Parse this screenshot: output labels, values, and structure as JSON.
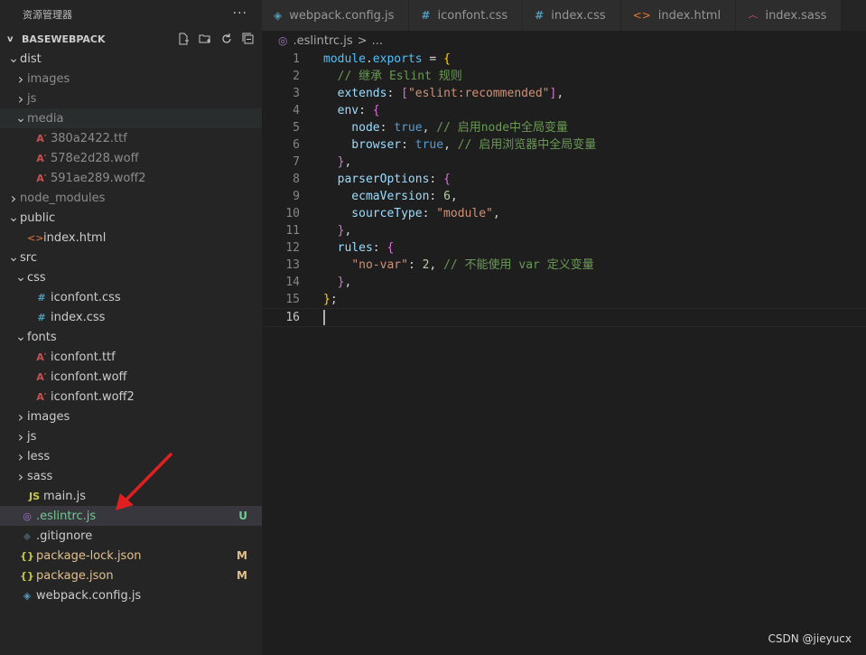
{
  "sidebar": {
    "title": "资源管理器",
    "more": "···",
    "section": "BASEWEBPACK",
    "actions": [
      "new-file",
      "new-folder",
      "refresh",
      "collapse-all"
    ],
    "tree": [
      {
        "label": "dist",
        "indent": 1,
        "twistie": "v",
        "icon": "",
        "kind": "folder"
      },
      {
        "label": "images",
        "indent": 2,
        "twistie": ">",
        "icon": "",
        "kind": "folder",
        "dim": true
      },
      {
        "label": "js",
        "indent": 2,
        "twistie": ">",
        "icon": "",
        "kind": "folder",
        "dim": true
      },
      {
        "label": "media",
        "indent": 2,
        "twistie": "v",
        "icon": "",
        "kind": "folder",
        "dim": true,
        "hover": true
      },
      {
        "label": "380a2422.ttf",
        "indent": 3,
        "twistie": "",
        "icon": "font",
        "kind": "file",
        "dim": true
      },
      {
        "label": "578e2d28.woff",
        "indent": 3,
        "twistie": "",
        "icon": "font",
        "kind": "file",
        "dim": true
      },
      {
        "label": "591ae289.woff2",
        "indent": 3,
        "twistie": "",
        "icon": "font",
        "kind": "file",
        "dim": true
      },
      {
        "label": "node_modules",
        "indent": 1,
        "twistie": ">",
        "icon": "",
        "kind": "folder",
        "dim": true
      },
      {
        "label": "public",
        "indent": 1,
        "twistie": "v",
        "icon": "",
        "kind": "folder"
      },
      {
        "label": "index.html",
        "indent": 2,
        "twistie": "",
        "icon": "html",
        "kind": "file"
      },
      {
        "label": "src",
        "indent": 1,
        "twistie": "v",
        "icon": "",
        "kind": "folder"
      },
      {
        "label": "css",
        "indent": 2,
        "twistie": "v",
        "icon": "",
        "kind": "folder"
      },
      {
        "label": "iconfont.css",
        "indent": 3,
        "twistie": "",
        "icon": "css",
        "kind": "file"
      },
      {
        "label": "index.css",
        "indent": 3,
        "twistie": "",
        "icon": "css",
        "kind": "file"
      },
      {
        "label": "fonts",
        "indent": 2,
        "twistie": "v",
        "icon": "",
        "kind": "folder"
      },
      {
        "label": "iconfont.ttf",
        "indent": 3,
        "twistie": "",
        "icon": "font",
        "kind": "file"
      },
      {
        "label": "iconfont.woff",
        "indent": 3,
        "twistie": "",
        "icon": "font",
        "kind": "file"
      },
      {
        "label": "iconfont.woff2",
        "indent": 3,
        "twistie": "",
        "icon": "font",
        "kind": "file"
      },
      {
        "label": "images",
        "indent": 2,
        "twistie": ">",
        "icon": "",
        "kind": "folder"
      },
      {
        "label": "js",
        "indent": 2,
        "twistie": ">",
        "icon": "",
        "kind": "folder"
      },
      {
        "label": "less",
        "indent": 2,
        "twistie": ">",
        "icon": "",
        "kind": "folder"
      },
      {
        "label": "sass",
        "indent": 2,
        "twistie": ">",
        "icon": "",
        "kind": "folder"
      },
      {
        "label": "main.js",
        "indent": 2,
        "twistie": "",
        "icon": "js",
        "kind": "file"
      },
      {
        "label": ".eslintrc.js",
        "indent": 1,
        "twistie": "",
        "icon": "eslint",
        "kind": "file",
        "selected": true,
        "badge": "U",
        "badge_color": "#73c991",
        "label_color": "#73c991"
      },
      {
        "label": ".gitignore",
        "indent": 1,
        "twistie": "",
        "icon": "git",
        "kind": "file"
      },
      {
        "label": "package-lock.json",
        "indent": 1,
        "twistie": "",
        "icon": "json",
        "kind": "file",
        "badge": "M",
        "badge_color": "#e2c08d",
        "label_color": "#e2c08d"
      },
      {
        "label": "package.json",
        "indent": 1,
        "twistie": "",
        "icon": "json",
        "kind": "file",
        "badge": "M",
        "badge_color": "#e2c08d",
        "label_color": "#e2c08d"
      },
      {
        "label": "webpack.config.js",
        "indent": 1,
        "twistie": "",
        "icon": "webpack",
        "kind": "file"
      }
    ]
  },
  "tabs": [
    {
      "label": "webpack.config.js",
      "icon": "webpack"
    },
    {
      "label": "iconfont.css",
      "icon": "css"
    },
    {
      "label": "index.css",
      "icon": "css"
    },
    {
      "label": "index.html",
      "icon": "html"
    },
    {
      "label": "index.sass",
      "icon": "sass"
    }
  ],
  "breadcrumb": {
    "file": ".eslintrc.js",
    "sep": ">",
    "rest": "..."
  },
  "editor": {
    "active_line": 16,
    "lines": [
      [
        [
          "module",
          "t-var"
        ],
        [
          ".",
          "t-op"
        ],
        [
          "exports",
          "t-var"
        ],
        [
          " = ",
          "t-op"
        ],
        [
          "{",
          "t-br1"
        ]
      ],
      [
        [
          "  // 继承 Eslint 规则",
          "t-com"
        ]
      ],
      [
        [
          "  extends",
          "t-prop"
        ],
        [
          ": ",
          "t-op"
        ],
        [
          "[",
          "t-br2"
        ],
        [
          "\"eslint:recommended\"",
          "t-str"
        ],
        [
          "]",
          "t-br2"
        ],
        [
          ",",
          "t-op"
        ]
      ],
      [
        [
          "  env",
          "t-prop"
        ],
        [
          ": ",
          "t-op"
        ],
        [
          "{",
          "t-br2"
        ]
      ],
      [
        [
          "    node",
          "t-prop"
        ],
        [
          ": ",
          "t-op"
        ],
        [
          "true",
          "t-kw"
        ],
        [
          ", ",
          "t-op"
        ],
        [
          "// 启用node中全局变量",
          "t-com"
        ]
      ],
      [
        [
          "    browser",
          "t-prop"
        ],
        [
          ": ",
          "t-op"
        ],
        [
          "true",
          "t-kw"
        ],
        [
          ", ",
          "t-op"
        ],
        [
          "// 启用浏览器中全局变量",
          "t-com"
        ]
      ],
      [
        [
          "  ",
          "t-op"
        ],
        [
          "}",
          "t-br2"
        ],
        [
          ",",
          "t-op"
        ]
      ],
      [
        [
          "  parserOptions",
          "t-prop"
        ],
        [
          ": ",
          "t-op"
        ],
        [
          "{",
          "t-br2"
        ]
      ],
      [
        [
          "    ecmaVersion",
          "t-prop"
        ],
        [
          ": ",
          "t-op"
        ],
        [
          "6",
          "t-num"
        ],
        [
          ",",
          "t-op"
        ]
      ],
      [
        [
          "    sourceType",
          "t-prop"
        ],
        [
          ": ",
          "t-op"
        ],
        [
          "\"module\"",
          "t-str"
        ],
        [
          ",",
          "t-op"
        ]
      ],
      [
        [
          "  ",
          "t-op"
        ],
        [
          "}",
          "t-br2"
        ],
        [
          ",",
          "t-op"
        ]
      ],
      [
        [
          "  rules",
          "t-prop"
        ],
        [
          ": ",
          "t-op"
        ],
        [
          "{",
          "t-br2"
        ]
      ],
      [
        [
          "    ",
          "t-op"
        ],
        [
          "\"no-var\"",
          "t-str"
        ],
        [
          ": ",
          "t-op"
        ],
        [
          "2",
          "t-num"
        ],
        [
          ", ",
          "t-op"
        ],
        [
          "// 不能使用 var 定义变量",
          "t-com"
        ]
      ],
      [
        [
          "  ",
          "t-op"
        ],
        [
          "}",
          "t-br2"
        ],
        [
          ",",
          "t-op"
        ]
      ],
      [
        [
          "}",
          "t-br1"
        ],
        [
          ";",
          "t-op"
        ]
      ],
      []
    ]
  },
  "watermark": "CSDN @jieyucx",
  "colors": {
    "annotation_arrow": "#e02020",
    "untracked": "#73c991",
    "modified": "#e2c08d"
  }
}
